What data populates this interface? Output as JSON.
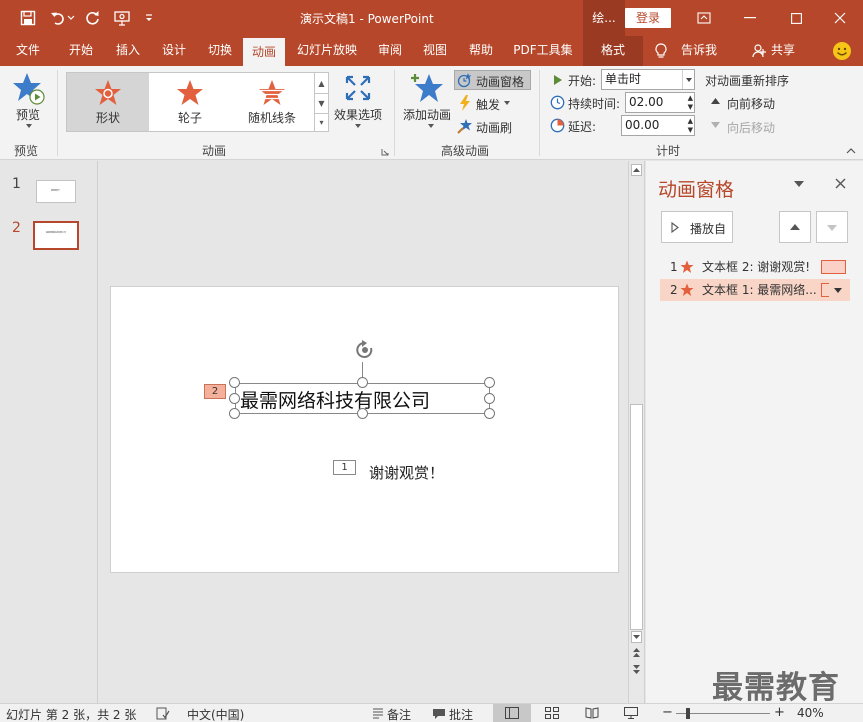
{
  "window": {
    "doc_title": "演示文稿1 - PowerPoint",
    "context_tab": "绘...",
    "login": "登录"
  },
  "tabs": {
    "file": "文件",
    "home": "开始",
    "insert": "插入",
    "design": "设计",
    "transitions": "切换",
    "animations": "动画",
    "slideshow": "幻灯片放映",
    "review": "审阅",
    "view": "视图",
    "help": "帮助",
    "pdf": "PDF工具集",
    "format": "格式",
    "tellme": "告诉我",
    "share": "共享"
  },
  "ribbon": {
    "preview_btn": "预览",
    "preview_group": "预览",
    "gallery": [
      {
        "label": "形状"
      },
      {
        "label": "轮子"
      },
      {
        "label": "随机线条"
      }
    ],
    "effect_options": "效果选项",
    "animation_group": "动画",
    "add_animation": "添加动画",
    "animation_pane": "动画窗格",
    "trigger": "触发",
    "anim_painter": "动画刷",
    "advanced_group": "高级动画",
    "start_label": "开始:",
    "start_value": "单击时",
    "duration_label": "持续时间:",
    "duration_value": "02.00",
    "delay_label": "延迟:",
    "delay_value": "00.00",
    "reorder_label": "对动画重新排序",
    "move_earlier": "向前移动",
    "move_later": "向后移动",
    "timing_group": "计时"
  },
  "thumbs": {
    "n1": "1",
    "n2": "2",
    "t1_text": "谢谢观赏！",
    "t2_text": "最需网络科技有限公司"
  },
  "slide": {
    "title_text": "最需网络科技有限公司",
    "title_tag": "2",
    "sub_text": "谢谢观赏！",
    "sub_tag": "1"
  },
  "pane": {
    "title": "动画窗格",
    "play_from": "播放自",
    "items": [
      {
        "num": "1",
        "label": "文本框 2: 谢谢观赏!"
      },
      {
        "num": "2",
        "label": "文本框 1: 最需网络..."
      }
    ]
  },
  "status": {
    "slide_info": "幻灯片 第 2 张，共 2 张",
    "language": "中文(中国)",
    "notes": "备注",
    "comments": "批注",
    "zoom": "40%"
  },
  "watermark": "最需教育",
  "colors": {
    "accent": "#b7472a",
    "star": "#e2603e",
    "selected_item": "#f8d5c6"
  }
}
